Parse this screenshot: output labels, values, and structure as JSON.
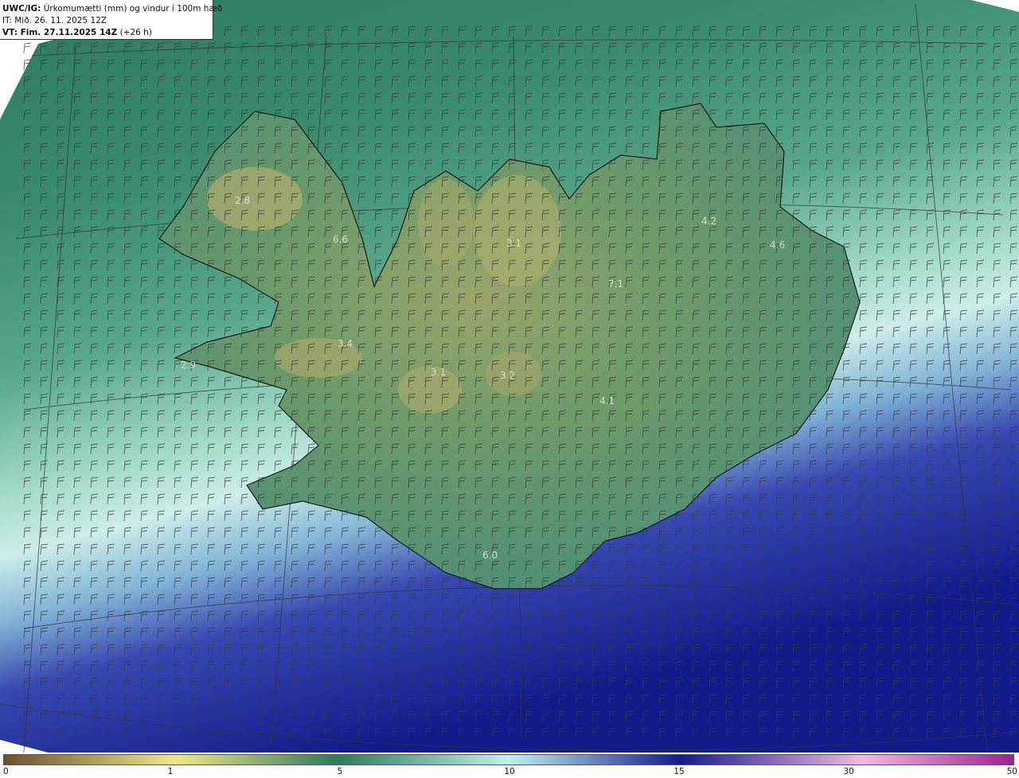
{
  "header": {
    "product": "UWC/IG:",
    "product_desc": "Úrkomumætti (mm) og vindur í 100m hæð",
    "init_time": "IT: Mið. 26. 11. 2025 12Z",
    "valid_prefix": "VT: Fim. 27.11.2025 14Z",
    "valid_suffix": "(+26 h)"
  },
  "map": {
    "value_labels": [
      "2.8",
      "6.6",
      "3.1",
      "4.2",
      "4.6",
      "7.1",
      "3.4",
      "2.9",
      "3.1",
      "3.2",
      "4.1",
      "6.0"
    ]
  },
  "colorbar": {
    "ticks": [
      "0",
      "1",
      "5",
      "10",
      "15",
      "30",
      "50"
    ],
    "colors": {
      "brown": "#6b4f2f",
      "yellow": "#f2e68c",
      "green": "#2d7a5c",
      "cyan": "#bff2ee",
      "navy": "#131a8f",
      "magenta": "#a0208e"
    }
  }
}
